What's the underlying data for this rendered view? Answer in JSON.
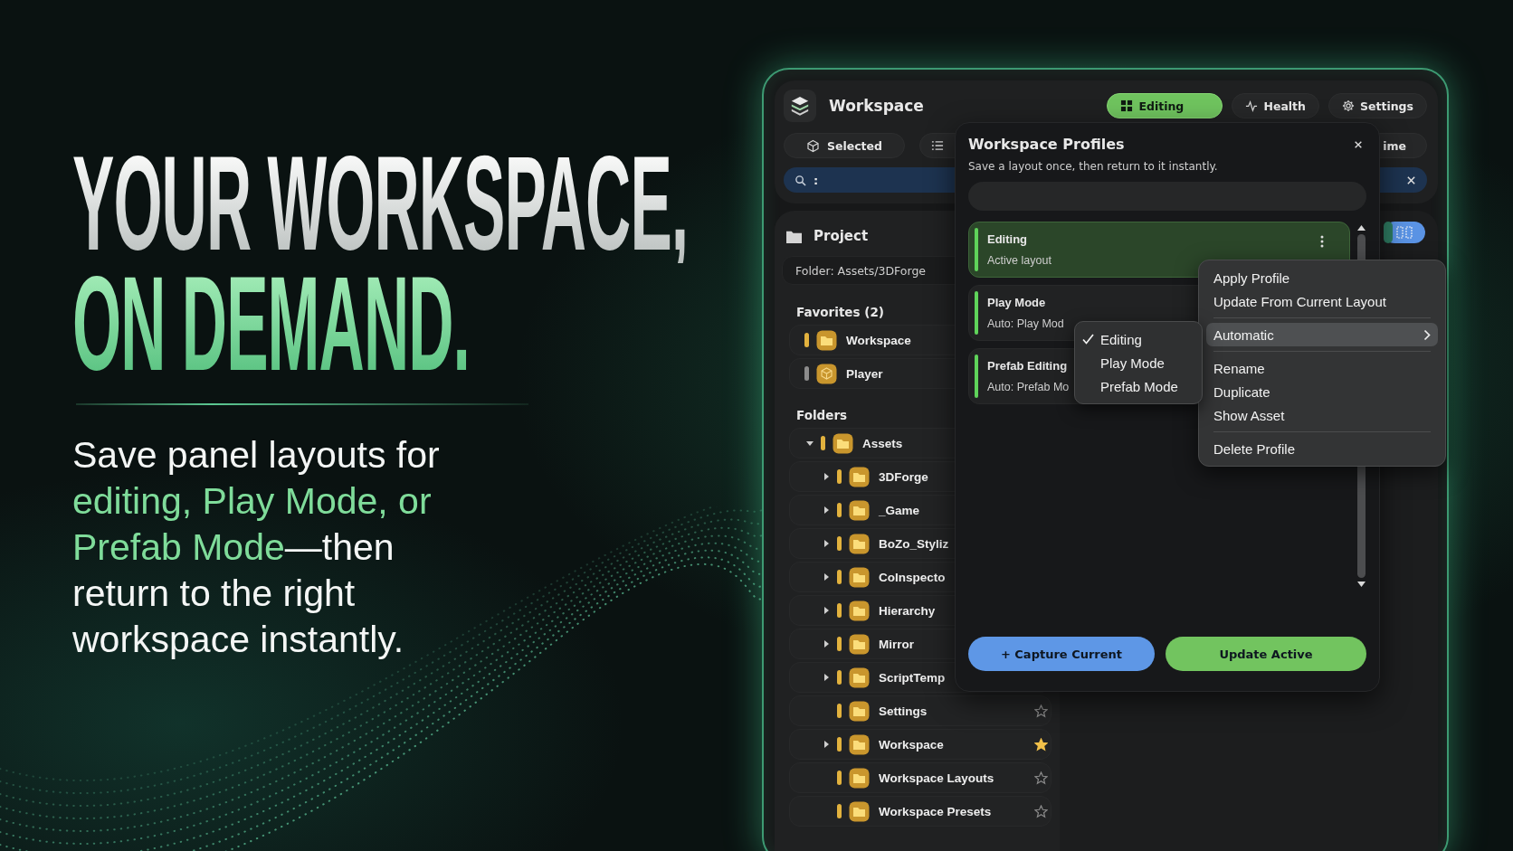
{
  "hero": {
    "headline": [
      {
        "text": "YOUR WORKSPACE,",
        "accent": false
      },
      {
        "text": "ON DEMAND.",
        "accent": true
      }
    ],
    "body": [
      {
        "text": "Save panel layouts for ",
        "accent": false
      },
      {
        "text": "editing, Play Mode, or Prefab Mode",
        "accent": true
      },
      {
        "text": "—then return to the right workspace instantly.",
        "accent": false
      }
    ]
  },
  "app": {
    "title": "Workspace",
    "mode_tabs": [
      {
        "label": "Editing",
        "selected": true
      },
      {
        "label": "Health",
        "selected": false
      },
      {
        "label": "Settings",
        "selected": false
      }
    ],
    "filter_buttons": [
      {
        "label": "Selected"
      },
      {
        "label": "ime"
      }
    ],
    "search": {
      "value": ":"
    }
  },
  "project": {
    "title": "Project",
    "folder_field": "Folder: Assets/3DForge",
    "favorites_title": "Favorites (2)",
    "favorites": [
      {
        "label": "Workspace",
        "color": "#e2b23e"
      },
      {
        "label": "Player",
        "color": "#8c8c8c"
      }
    ],
    "folders_title": "Folders",
    "folders": [
      {
        "label": "Assets",
        "kind": "branch",
        "expanded": true,
        "children": [
          {
            "label": "3DForge",
            "kind": "branch",
            "expanded": false
          },
          {
            "label": "_Game",
            "kind": "branch",
            "expanded": false
          },
          {
            "label": "BoZo_Styliz",
            "kind": "branch",
            "expanded": false
          },
          {
            "label": "CoInspecto",
            "kind": "branch",
            "expanded": false
          },
          {
            "label": "Hierarchy",
            "kind": "branch",
            "expanded": false
          },
          {
            "label": "Mirror",
            "kind": "branch",
            "expanded": false
          },
          {
            "label": "ScriptTemp",
            "kind": "branch",
            "expanded": false
          },
          {
            "label": "Settings",
            "kind": "leaf",
            "favorite": false
          },
          {
            "label": "Workspace",
            "kind": "branch",
            "expanded": false,
            "favorite": true
          },
          {
            "label": "Workspace Layouts",
            "kind": "leaf",
            "favorite": false
          },
          {
            "label": "Workspace Presets",
            "kind": "leaf",
            "favorite": false
          }
        ]
      }
    ]
  },
  "dialog": {
    "title": "Workspace Profiles",
    "subtitle": "Save a layout once, then return to it instantly.",
    "profiles": [
      {
        "name": "Editing",
        "detail": "Active layout",
        "selected": true
      },
      {
        "name": "Play Mode",
        "detail": "Auto: Play Mod",
        "selected": false
      },
      {
        "name": "Prefab Editing",
        "detail": "Auto: Prefab Mo",
        "selected": false
      }
    ],
    "buttons": [
      {
        "label": "+ Capture Current",
        "kind": "secondary"
      },
      {
        "label": "Update Active",
        "kind": "primary"
      }
    ]
  },
  "context_menu": {
    "groups": [
      [
        {
          "label": "Apply Profile",
          "kind": "action",
          "highlighted": false
        },
        {
          "label": "Update From Current Layout",
          "kind": "action",
          "highlighted": false
        }
      ],
      [
        {
          "label": "Automatic",
          "kind": "submenu",
          "highlighted": true
        }
      ],
      [
        {
          "label": "Rename",
          "kind": "action",
          "highlighted": false
        },
        {
          "label": "Duplicate",
          "kind": "action",
          "highlighted": false
        },
        {
          "label": "Show Asset",
          "kind": "action",
          "highlighted": false
        }
      ],
      [
        {
          "label": "Delete Profile",
          "kind": "action",
          "highlighted": false
        }
      ]
    ]
  },
  "submenu": {
    "items": [
      {
        "label": "Editing",
        "checked": true
      },
      {
        "label": "Play Mode",
        "checked": false
      },
      {
        "label": "Prefab Mode",
        "checked": false
      }
    ]
  }
}
